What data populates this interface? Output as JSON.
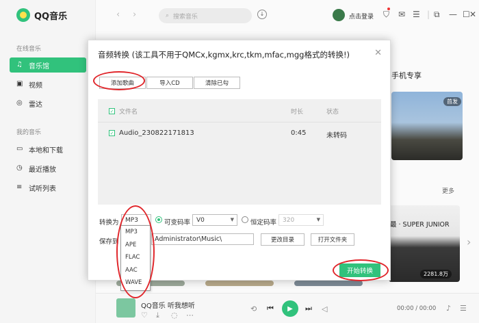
{
  "app": {
    "logo_text": "QQ音乐",
    "brand_color": "#31c27c",
    "accent_red": "#e0262b"
  },
  "sidebar": {
    "section_online": "在线音乐",
    "online_items": [
      {
        "label": "音乐馆",
        "icon": "music-note-icon",
        "active": true
      },
      {
        "label": "视频",
        "icon": "video-icon",
        "active": false
      },
      {
        "label": "雷达",
        "icon": "radar-icon",
        "active": false
      }
    ],
    "section_mine": "我的音乐",
    "mine_items": [
      {
        "label": "本地和下载",
        "icon": "monitor-icon"
      },
      {
        "label": "最近播放",
        "icon": "clock-icon"
      },
      {
        "label": "试听列表",
        "icon": "playlist-icon"
      }
    ]
  },
  "topbar": {
    "search_placeholder": "搜索音乐",
    "login_text": "点击登录"
  },
  "background": {
    "phone_exclusive": "手机专享",
    "first_release": "首发",
    "more": "更多",
    "super_junior": "最 · SUPER JUNIOR",
    "play_count": "2281.8万"
  },
  "dialog": {
    "title": "音频转换 (该工具不用于QMCx,kgmx,krc,tkm,mfac,mgg格式的转换!)",
    "buttons": {
      "add_song": "添加歌曲",
      "import_cd": "导入CD",
      "clear_done": "清除已勾"
    },
    "list": {
      "columns": {
        "filename": "文件名",
        "duration": "时长",
        "status": "状态"
      },
      "rows": [
        {
          "filename": "Audio_230822171813",
          "duration": "0:45",
          "status": "未转码"
        }
      ]
    },
    "convert_to_label": "转换为",
    "format_selected": "MP3",
    "format_options": [
      "MP3",
      "APE",
      "FLAC",
      "AAC",
      "WAVE"
    ],
    "vbr_label": "可变码率",
    "vbr_value": "V0",
    "cbr_label": "恒定码率",
    "cbr_value": "320",
    "save_to_label": "保存到",
    "save_path": "Administrator\\Music\\",
    "change_dir": "更改目录",
    "open_folder": "打开文件夹",
    "start_convert": "开始转换"
  },
  "player": {
    "song_title": "QQ音乐 听我想听",
    "time": "00:00 / 00:00"
  }
}
